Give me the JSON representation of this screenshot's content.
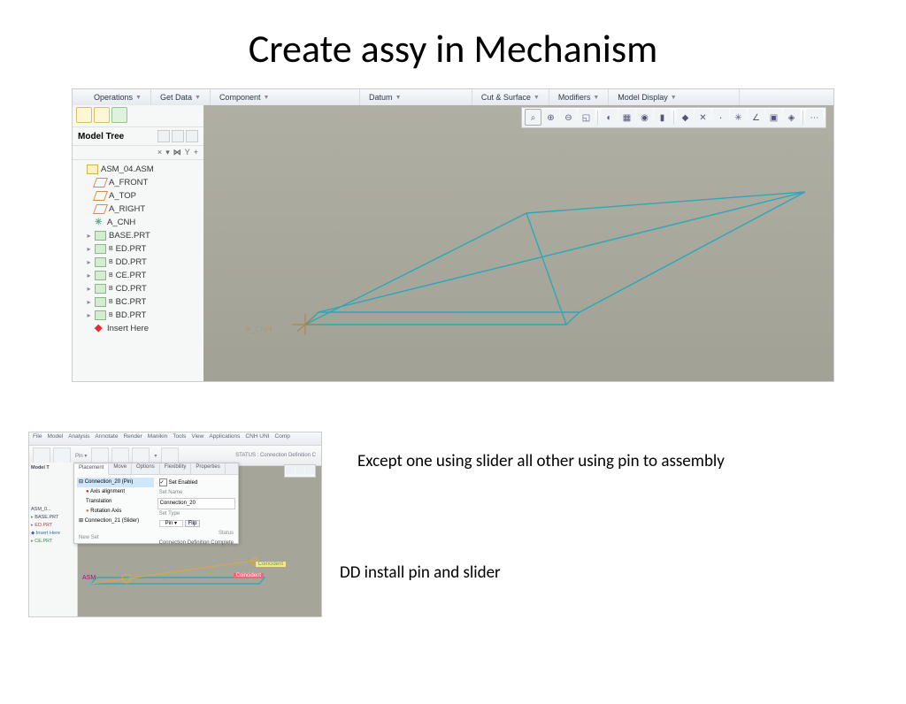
{
  "slide": {
    "title": "Create assy in Mechanism"
  },
  "annotations": {
    "line1": "Except one using slider all other using pin to assembly",
    "line2": "DD install pin and slider"
  },
  "cad_main": {
    "menu": [
      "Operations",
      "Get Data",
      "Component",
      "Datum",
      "Cut & Surface",
      "Modifiers",
      "Model Display"
    ],
    "model_tree_title": "Model Tree",
    "tree": {
      "root": "ASM_04.ASM",
      "datums": [
        "A_FRONT",
        "A_TOP",
        "A_RIGHT"
      ],
      "csys": "A_CNH",
      "parts": [
        "BASE.PRT",
        "ED.PRT",
        "DD.PRT",
        "CE.PRT",
        "CD.PRT",
        "BC.PRT",
        "BD.PRT"
      ],
      "insert": "Insert Here"
    },
    "origin_label": "A_CNH"
  },
  "cad_small": {
    "menu": [
      "File",
      "Model",
      "Analysis",
      "Annotate",
      "Render",
      "Manikin",
      "Tools",
      "View",
      "Applications",
      "CNH UNI",
      "Comp"
    ],
    "status": "STATUS : Connection Definition C",
    "panel": {
      "tabs": [
        "Placement",
        "Move",
        "Options",
        "Flexibility",
        "Properties"
      ],
      "conn_item": "Connection_20 (Pin)",
      "sub_items": [
        "Axis alignment",
        "Translation",
        "Rotation Axis"
      ],
      "conn_item2": "Connection_21 (Slider)",
      "new_set": "New Set",
      "enabled_label": "Set Enabled",
      "setname_label": "Set Name",
      "setname_value": "Connection_20",
      "settype_label": "Set Type",
      "settype_value": "Pin",
      "flip": "Flip",
      "status_label": "Status",
      "status_value": "Connection Definition Complete"
    },
    "tree_title": "Model T",
    "tree_root": "ASM_0...",
    "tree_items": [
      "BASE.PRT",
      "ED.PRT",
      "Insert Here",
      "CE.PRT"
    ],
    "view_label1": "Coincident",
    "view_label2": "Coincident",
    "origin": "ASM"
  }
}
